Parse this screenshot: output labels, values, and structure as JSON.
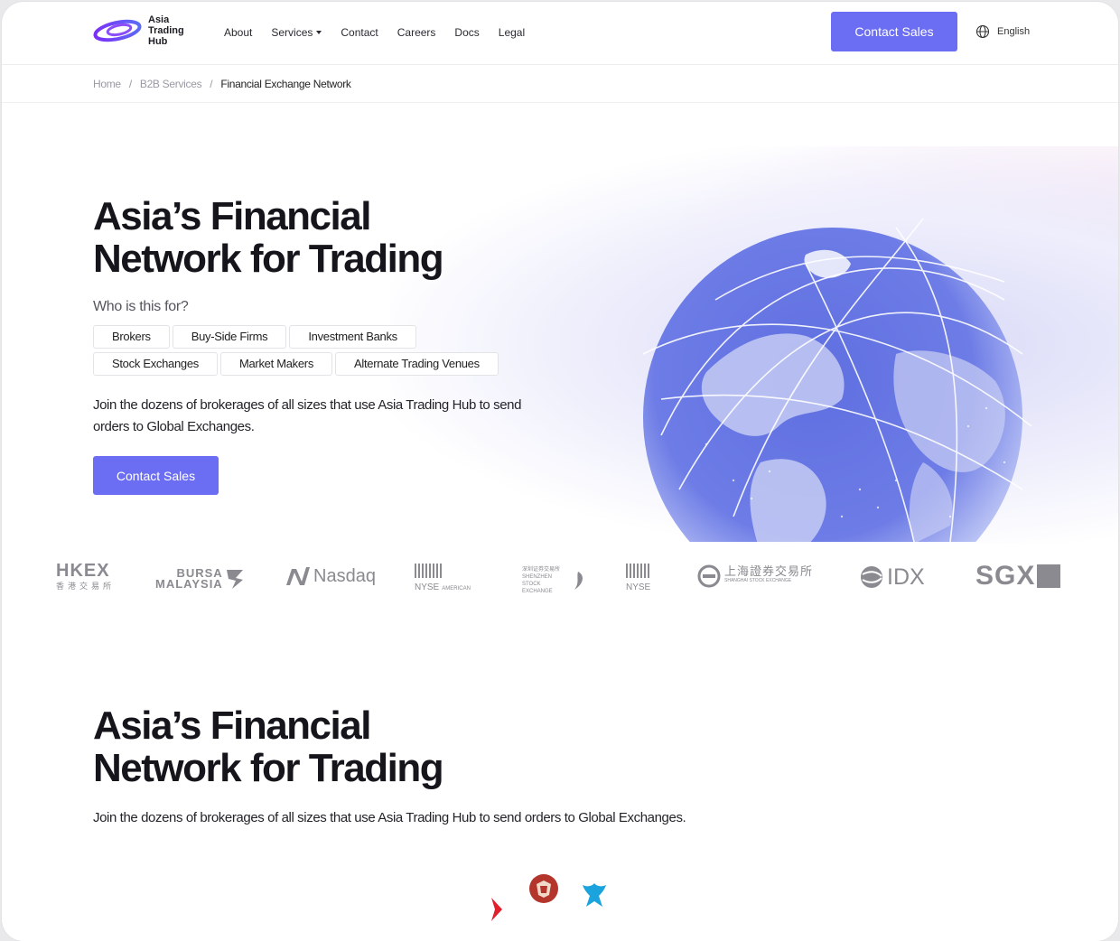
{
  "brand": {
    "name": "Asia Trading Hub",
    "accent": "#6b6df2"
  },
  "nav": {
    "items": [
      "About",
      "Services",
      "Contact",
      "Careers",
      "Docs",
      "Legal"
    ],
    "cta": "Contact Sales",
    "language": "English"
  },
  "breadcrumb": [
    "Home",
    "B2B Services",
    "Financial Exchange Network"
  ],
  "hero": {
    "title": "Asia’s Financial Network for Trading",
    "who_label": "Who is this for?",
    "audiences": [
      "Brokers",
      "Buy-Side Firms",
      "Investment Banks",
      "Stock Exchanges",
      "Market Makers",
      "Alternate Trading Venues"
    ],
    "description": "Join the dozens of brokerages of all sizes that use Asia Trading Hub to send orders to Global Exchanges.",
    "cta": "Contact Sales"
  },
  "exchanges": {
    "hkex": "HKEX",
    "hkex_sub": "香港交易所",
    "bursa_1": "BURSA",
    "bursa_2": "MALAYSIA",
    "nasdaq": "Nasdaq",
    "nyse_american": "NYSE",
    "nyse_american_sub": "AMERICAN",
    "szse": "深圳证券交易所",
    "szse_sub": "SHENZHEN STOCK EXCHANGE",
    "nyse": "NYSE",
    "sse": "上海證券交易所",
    "sse_sub": "SHANGHAI STOCK EXCHANGE",
    "idx": "IDX",
    "sgx": "SGX"
  },
  "section2": {
    "title": "Asia’s Financial Network for Trading",
    "description": "Join the dozens of brokerages of all sizes that use Asia Trading Hub to send orders to Global Exchanges."
  }
}
